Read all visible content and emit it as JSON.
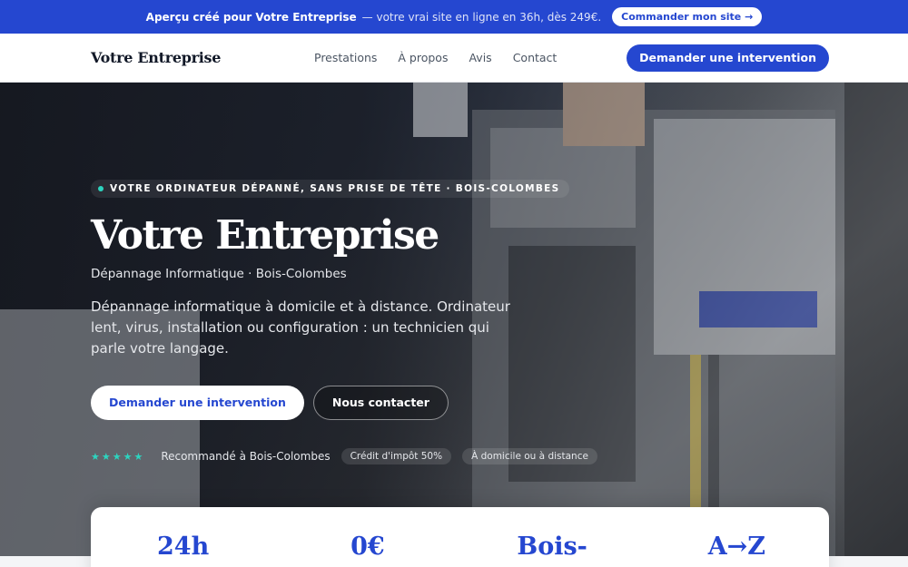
{
  "announcement": {
    "lead": "Aperçu créé pour Votre Entreprise",
    "rest": "— votre vrai site en ligne en 36h, dès 249€.",
    "cta": "Commander mon site →"
  },
  "header": {
    "brand": "Votre Entreprise",
    "nav": [
      "Prestations",
      "À propos",
      "Avis",
      "Contact"
    ],
    "cta": "Demander une intervention"
  },
  "hero": {
    "eyebrow": "VOTRE ORDINATEUR DÉPANNÉ, SANS PRISE DE TÊTE · BOIS-COLOMBES",
    "title": "Votre Entreprise",
    "subtitle": "Dépannage Informatique · Bois-Colombes",
    "description": "Dépannage informatique à domicile et à distance. Ordinateur lent, virus, installation ou configuration : un technicien qui parle votre langage.",
    "primary_cta": "Demander une intervention",
    "secondary_cta": "Nous contacter",
    "stars": "★★★★★",
    "recommendation": "Recommandé à Bois-Colombes",
    "chips": [
      "Crédit d'impôt 50%",
      "À domicile ou à distance"
    ]
  },
  "stats": [
    "24h",
    "0€",
    "Bois-",
    "A→Z"
  ],
  "colors": {
    "accent": "#2547d0",
    "star": "#2dd4bf"
  }
}
